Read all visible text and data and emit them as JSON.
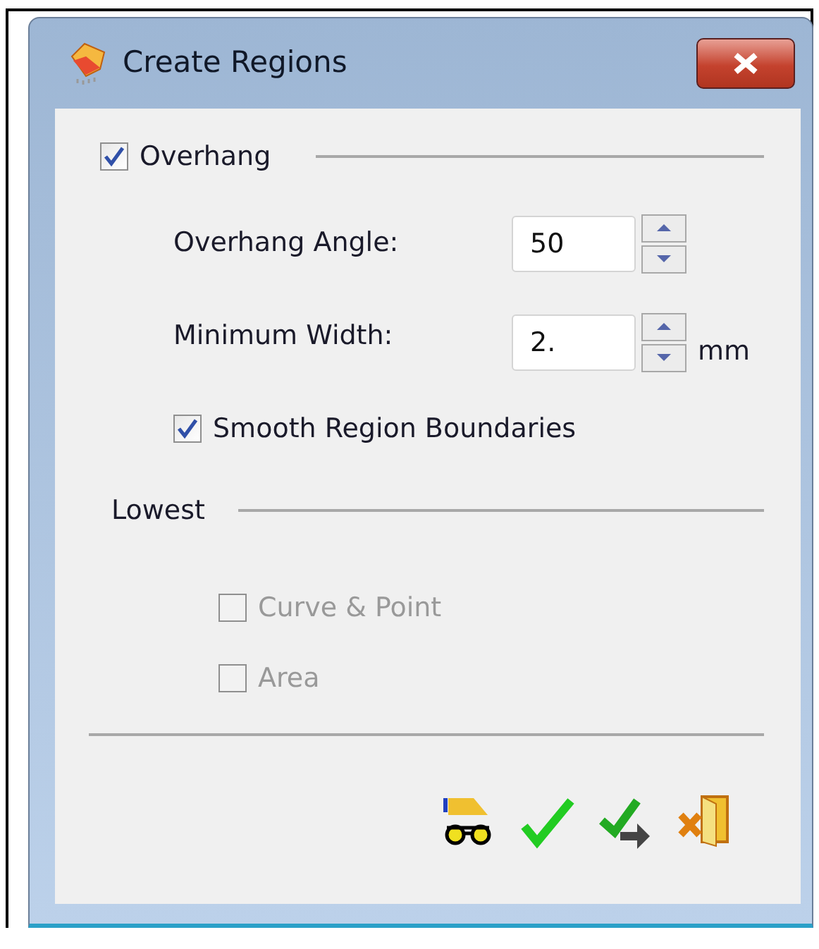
{
  "window": {
    "title": "Create Regions"
  },
  "overhang": {
    "label": "Overhang",
    "checked": true,
    "fields": [
      {
        "label": "Overhang Angle:",
        "value": "50"
      },
      {
        "label": "Minimum Width:",
        "value": "2.",
        "unit": "mm"
      }
    ],
    "smooth": {
      "label": "Smooth Region Boundaries",
      "checked": true
    }
  },
  "lowest": {
    "label": "Lowest",
    "options": [
      {
        "label": "Curve & Point",
        "checked": false,
        "disabled": true
      },
      {
        "label": "Area",
        "checked": false,
        "disabled": true
      }
    ]
  }
}
